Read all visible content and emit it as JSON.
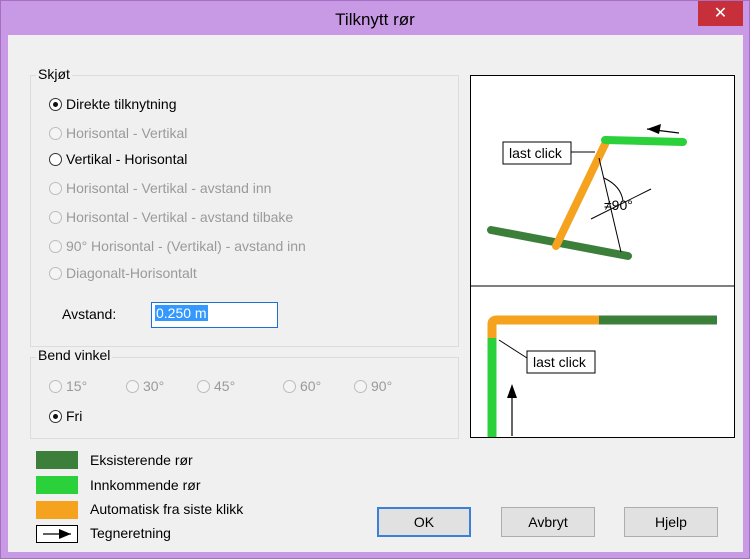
{
  "window": {
    "title": "Tilknytt rør",
    "close_glyph": "✕"
  },
  "joint_group": {
    "label": "Skjøt",
    "options": [
      {
        "label": "Direkte tilknytning",
        "checked": true,
        "disabled": false
      },
      {
        "label": "Horisontal - Vertikal",
        "checked": false,
        "disabled": true
      },
      {
        "label": "Vertikal - Horisontal",
        "checked": false,
        "disabled": false
      },
      {
        "label": "Horisontal - Vertikal - avstand inn",
        "checked": false,
        "disabled": true
      },
      {
        "label": "Horisontal - Vertikal - avstand tilbake",
        "checked": false,
        "disabled": true
      },
      {
        "label": "90° Horisontal - (Vertikal) - avstand inn",
        "checked": false,
        "disabled": true
      },
      {
        "label": "Diagonalt-Horisontalt",
        "checked": false,
        "disabled": true
      }
    ],
    "distance_label": "Avstand:",
    "distance_value": "0.250 m"
  },
  "bend_group": {
    "label": "Bend vinkel",
    "angles": [
      {
        "label": "15°",
        "disabled": true
      },
      {
        "label": "30°",
        "disabled": true
      },
      {
        "label": "45°",
        "disabled": true
      },
      {
        "label": "60°",
        "disabled": true
      },
      {
        "label": "90°",
        "disabled": true
      }
    ],
    "free_label": "Fri",
    "free_checked": true
  },
  "preview": {
    "top_last_click": "last click",
    "angle_label": "≠90°",
    "bottom_last_click": "last click"
  },
  "legend": [
    {
      "label": "Eksisterende rør",
      "color": "#3b7f3b"
    },
    {
      "label": "Innkommende rør",
      "color": "#2bd13b"
    },
    {
      "label": "Automatisk fra siste klikk",
      "color": "#f5a21f"
    },
    {
      "label": "Tegneretning",
      "icon": "arrow-icon"
    }
  ],
  "buttons": {
    "ok": "OK",
    "cancel": "Avbryt",
    "help": "Hjelp"
  },
  "colors": {
    "existing": "#3b7f3b",
    "incoming": "#2bd13b",
    "auto": "#f5a21f"
  }
}
